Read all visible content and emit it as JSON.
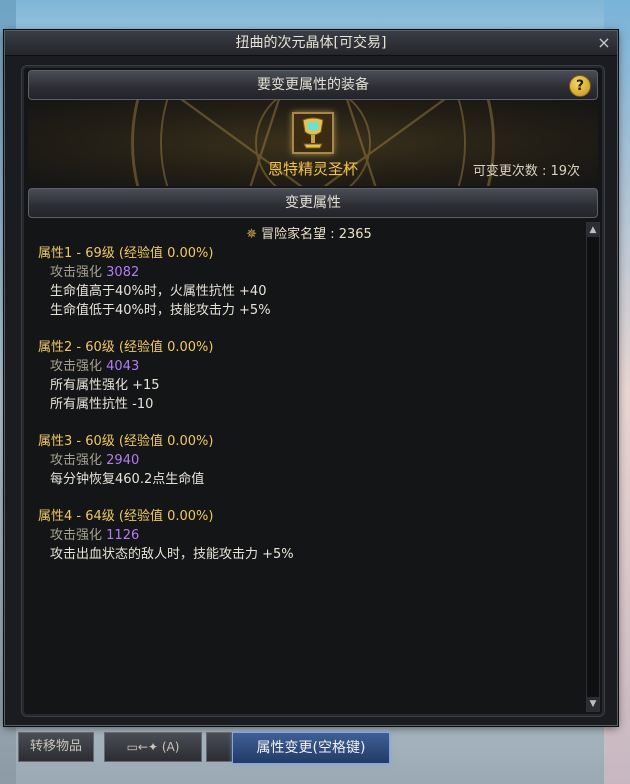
{
  "window": {
    "title": "扭曲的次元晶体[可交易]",
    "close_glyph": "×"
  },
  "equip_section": {
    "header": "要变更属性的装备",
    "help_glyph": "?",
    "item_name": "恩特精灵圣杯",
    "change_count_label": "可变更次数 : 19次"
  },
  "attr_section": {
    "header": "变更属性",
    "adventurer_fame": "冒险家名望 : 2365",
    "groups": [
      {
        "title": "属性1 - 69级 (经验值 0.00%)",
        "attack_label": "攻击强化",
        "attack_value": "3082",
        "lines": [
          "生命值高于40%时，火属性抗性 +40",
          "生命值低于40%时，技能攻击力 +5%"
        ]
      },
      {
        "title": "属性2 - 60级 (经验值 0.00%)",
        "attack_label": "攻击强化",
        "attack_value": "4043",
        "lines": [
          "所有属性强化 +15",
          "所有属性抗性 -10"
        ]
      },
      {
        "title": "属性3 - 60级 (经验值 0.00%)",
        "attack_label": "攻击强化",
        "attack_value": "2940",
        "lines": [
          "每分钟恢复460.2点生命值"
        ]
      },
      {
        "title": "属性4 - 64级 (经验值 0.00%)",
        "attack_label": "攻击强化",
        "attack_value": "1126",
        "lines": [
          "攻击出血状态的敌人时，技能攻击力 +5%"
        ]
      }
    ]
  },
  "bottom": {
    "transfer_label": "转移物品",
    "swap_label": "(A)",
    "change_button_label": "属性变更(空格键)"
  },
  "colors": {
    "gold_title": "#efc864",
    "item_name": "#f2c24a",
    "purple_value": "#b07ef0"
  }
}
